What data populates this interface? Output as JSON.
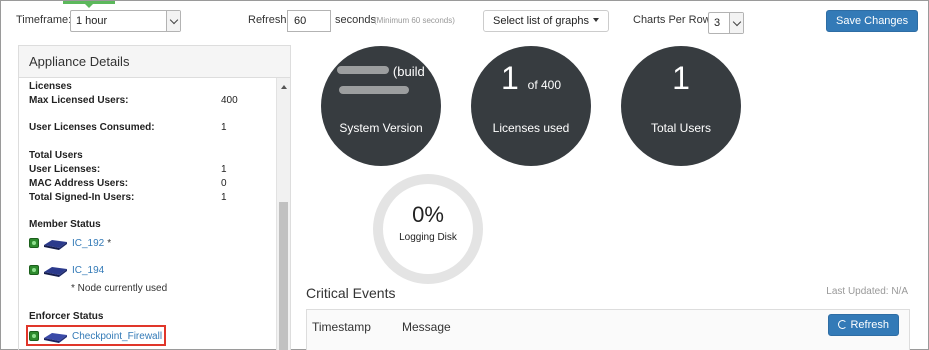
{
  "toolbar": {
    "timeframe_label": "Timeframe:",
    "timeframe_value": "1 hour",
    "refresh_label": "Refresh:",
    "refresh_value": "60",
    "refresh_unit": "seconds",
    "refresh_hint": "(Minimum 60 seconds)",
    "graphs_button": "Select list of graphs",
    "charts_per_row_label": "Charts Per Row:",
    "charts_per_row_value": "3",
    "save_button": "Save Changes"
  },
  "appliance": {
    "title": "Appliance Details",
    "licenses_heading": "Licenses",
    "max_licensed_users_label": "Max Licensed Users:",
    "max_licensed_users_value": "400",
    "user_licenses_consumed_label": "User Licenses Consumed:",
    "user_licenses_consumed_value": "1",
    "total_users_heading": "Total Users",
    "user_licenses_label": "User Licenses:",
    "user_licenses_value": "1",
    "mac_address_users_label": "MAC Address Users:",
    "mac_address_users_value": "0",
    "total_signed_in_label": "Total Signed-In Users:",
    "total_signed_in_value": "1",
    "member_status_heading": "Member Status",
    "members": [
      {
        "name": "IC_192",
        "suffix": "*"
      },
      {
        "name": "IC_194",
        "suffix": ""
      }
    ],
    "node_note": "* Node currently used",
    "enforcer_status_heading": "Enforcer Status",
    "enforcer_name": "Checkpoint_Firewall"
  },
  "charts": {
    "system_version_partial": "(build",
    "system_version_label": "System Version",
    "licenses_used_value": "1",
    "licenses_used_of": "of 400",
    "licenses_used_label": "Licenses used",
    "total_users_value": "1",
    "total_users_label": "Total Users",
    "logging_disk_value": "0%",
    "logging_disk_label": "Logging Disk"
  },
  "critical_events": {
    "title": "Critical Events",
    "last_updated": "Last Updated: N/A",
    "col_timestamp": "Timestamp",
    "col_message": "Message",
    "refresh_button": "Refresh"
  },
  "colors": {
    "accent": "#337ab7",
    "chart_circle": "#373c40",
    "status_ok": "#2e8b2e",
    "highlight": "#e0362a"
  }
}
